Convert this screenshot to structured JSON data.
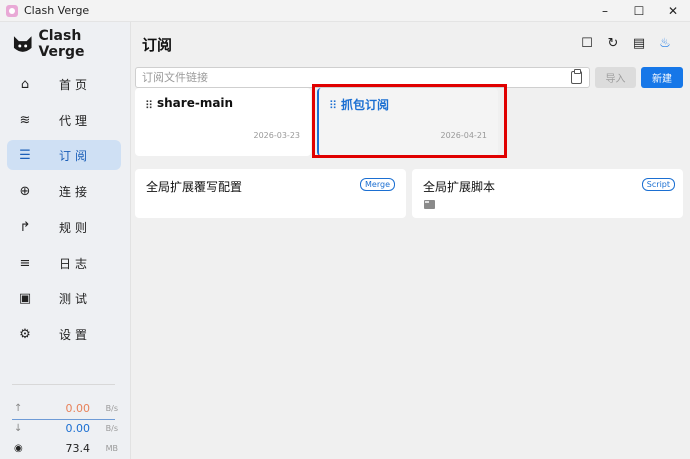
{
  "window": {
    "title": "Clash Verge",
    "minimize": "–",
    "maximize": "☐",
    "close": "✕"
  },
  "brand": {
    "name": "Clash Verge"
  },
  "sidebar": {
    "items": [
      {
        "label": "首页",
        "icon": "home-icon",
        "glyph": "⌂",
        "active": false
      },
      {
        "label": "代理",
        "icon": "wifi-icon",
        "glyph": "≋",
        "active": false
      },
      {
        "label": "订阅",
        "icon": "storage-icon",
        "glyph": "☰",
        "active": true
      },
      {
        "label": "连接",
        "icon": "globe-icon",
        "glyph": "⊕",
        "active": false
      },
      {
        "label": "规则",
        "icon": "fork-icon",
        "glyph": "↱",
        "active": false
      },
      {
        "label": "日志",
        "icon": "list-icon",
        "glyph": "≡",
        "active": false
      },
      {
        "label": "测试",
        "icon": "lock-icon",
        "glyph": "▣",
        "active": false
      },
      {
        "label": "设置",
        "icon": "gear-icon",
        "glyph": "⚙",
        "active": false
      }
    ]
  },
  "traffic": {
    "upload": {
      "arrow": "↑",
      "value": "0.00",
      "unit": "B/s",
      "color": "#e8825a"
    },
    "download": {
      "arrow": "↓",
      "value": "0.00",
      "unit": "B/s",
      "color": "#1b6fd2"
    },
    "memory": {
      "arrow": "◉",
      "value": "73.4",
      "unit": "MB",
      "color": "#222222"
    }
  },
  "main": {
    "title": "订阅",
    "toolbar": [
      "☐",
      "↻",
      "▤",
      "♨"
    ],
    "url_placeholder": "订阅文件链接",
    "import_label": "导入",
    "new_label": "新建"
  },
  "profiles": [
    {
      "name": "share-main",
      "date": "2026-03-23",
      "selected": false
    },
    {
      "name": "抓包订阅",
      "date": "2026-04-21",
      "selected": true
    }
  ],
  "extensions": [
    {
      "name": "全局扩展覆写配置",
      "badge": "Merge"
    },
    {
      "name": "全局扩展脚本",
      "badge": "Script"
    }
  ],
  "colors": {
    "accent": "#1677e8",
    "highlight": "#e00000"
  }
}
